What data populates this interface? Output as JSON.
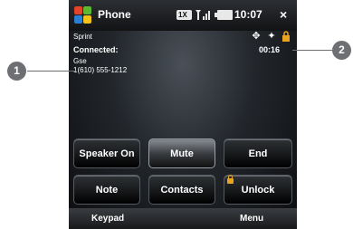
{
  "statusbar": {
    "app_title": "Phone",
    "network": "1X",
    "clock": "10:07",
    "close": "×"
  },
  "call": {
    "carrier": "Sprint",
    "status": "Connected:",
    "name": "Gse",
    "number": "1(610) 555-1212",
    "timer": "00:16"
  },
  "buttons": [
    {
      "label": "Speaker On"
    },
    {
      "label": "Mute"
    },
    {
      "label": "End"
    },
    {
      "label": "Note"
    },
    {
      "label": "Contacts"
    },
    {
      "label": "Unlock"
    }
  ],
  "softkeys": {
    "left": "Keypad",
    "right": "Menu"
  },
  "callouts": {
    "one": "1",
    "two": "2"
  },
  "colors": {
    "lock_accent": "#e8a321",
    "callout_gray": "#6d6f72"
  }
}
